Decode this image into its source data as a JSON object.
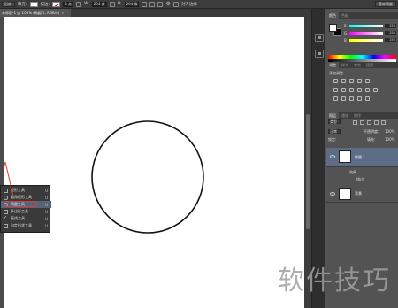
{
  "options_bar": {
    "tool_mode": "形状",
    "fill_label": "填充:",
    "stroke_label": "描边:",
    "stroke_width": "3 点",
    "width_label": "W:",
    "width_value": "294 像",
    "height_label": "H:",
    "height_value": "294 像",
    "align_edges": "对齐边缘",
    "workspace": "基本功能"
  },
  "document": {
    "tab_title": "未标题-1 @ 100% (椭圆 1, RGB/8)",
    "close_glyph": "×"
  },
  "color_panel": {
    "tabs": [
      "颜色",
      "色板"
    ],
    "sliders": [
      {
        "label": "R",
        "value": "255",
        "color": "#e23b3b"
      },
      {
        "label": "G",
        "value": "255",
        "color": "#3bbf4a"
      },
      {
        "label": "B",
        "value": "255",
        "color": "#3b5ee2"
      }
    ]
  },
  "adjust_panel": {
    "tabs": [
      "调整",
      "样式",
      "字符",
      "段落"
    ],
    "title": "添加调整"
  },
  "layers_panel": {
    "tabs": [
      "图层",
      "通道",
      "路径"
    ],
    "filter_kind": "类型",
    "blend_mode": "正常",
    "opacity_label": "不透明度:",
    "opacity_value": "100%",
    "lock_label": "锁定:",
    "fill_label": "填充:",
    "fill_value": "100%",
    "layers": [
      {
        "name": "椭圆 1",
        "selected": true
      },
      {
        "name": "背景",
        "selected": false
      }
    ],
    "effects_label": "效果",
    "stroke_effect": "描边"
  },
  "tool_flyout": {
    "items": [
      {
        "label": "矩形工具",
        "key": "U",
        "selected": false,
        "icon": "rectangle-icon"
      },
      {
        "label": "圆角矩形工具",
        "key": "U",
        "selected": false,
        "icon": "rounded-rectangle-icon"
      },
      {
        "label": "椭圆工具",
        "key": "U",
        "selected": true,
        "icon": "ellipse-icon"
      },
      {
        "label": "多边形工具",
        "key": "U",
        "selected": false,
        "icon": "polygon-icon"
      },
      {
        "label": "直线工具",
        "key": "U",
        "selected": false,
        "icon": "line-icon"
      },
      {
        "label": "自定形状工具",
        "key": "U",
        "selected": false,
        "icon": "custom-shape-icon"
      }
    ]
  },
  "watermark": "软件技巧",
  "colors": {
    "highlight": "#e53b3b",
    "selection": "#56647a",
    "canvas": "#ffffff"
  }
}
